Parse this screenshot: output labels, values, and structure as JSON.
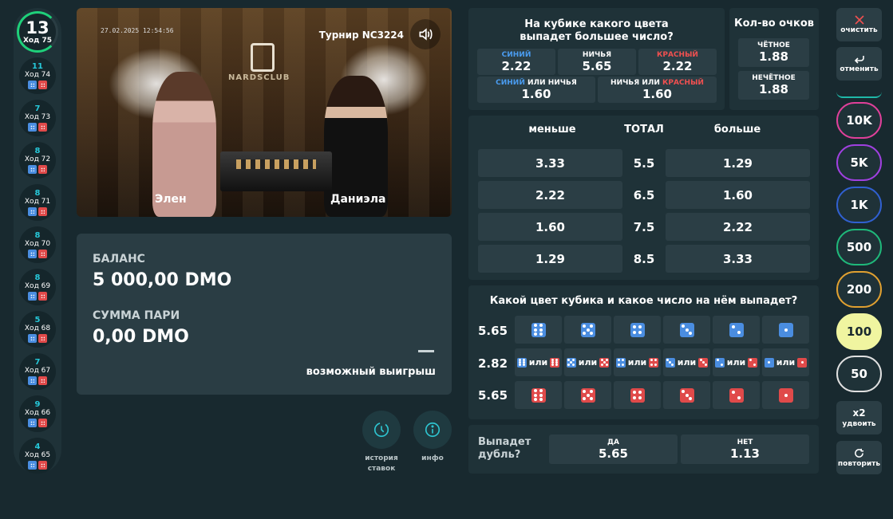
{
  "history": {
    "current": {
      "number": "13",
      "label": "Ход 75"
    },
    "items": [
      {
        "number": "11",
        "label": "Ход 74"
      },
      {
        "number": "7",
        "label": "Ход 73"
      },
      {
        "number": "8",
        "label": "Ход 72"
      },
      {
        "number": "8",
        "label": "Ход 71"
      },
      {
        "number": "8",
        "label": "Ход 70"
      },
      {
        "number": "8",
        "label": "Ход 69"
      },
      {
        "number": "5",
        "label": "Ход 68"
      },
      {
        "number": "7",
        "label": "Ход 67"
      },
      {
        "number": "9",
        "label": "Ход 66"
      },
      {
        "number": "4",
        "label": "Ход 65"
      }
    ]
  },
  "video": {
    "timestamp": "27.02.2025 12:54:56",
    "tournament": "Турнир NC3224",
    "logo": "NARDSCLUB",
    "dealer_left": "Элен",
    "dealer_right": "Даниэла"
  },
  "balance": {
    "balance_label": "БАЛАНС",
    "balance_value": "5 000,00 DMO",
    "bet_label": "СУММА ПАРИ",
    "bet_value": "0,00 DMO",
    "possible_win_label": "возможный выигрыш"
  },
  "actions": {
    "history_label_1": "история",
    "history_label_2": "ставок",
    "info_label": "инфо"
  },
  "color_bet": {
    "title_1": "На кубике какого цвета",
    "title_2": "выпадет большее число?",
    "blue": {
      "label": "СИНИЙ",
      "odds": "2.22"
    },
    "draw": {
      "label": "НИЧЬЯ",
      "odds": "5.65"
    },
    "red": {
      "label": "КРАСНЫЙ",
      "odds": "2.22"
    },
    "blue_or_draw": {
      "label_a": "СИНИЙ",
      "label_or": "ИЛИ",
      "label_b": "НИЧЬЯ",
      "odds": "1.60"
    },
    "draw_or_red": {
      "label_a": "НИЧЬЯ",
      "label_or": "ИЛИ",
      "label_b": "КРАСНЫЙ",
      "odds": "1.60"
    }
  },
  "points": {
    "title": "Кол-во очков",
    "even": {
      "label": "ЧЁТНОЕ",
      "odds": "1.88"
    },
    "odd": {
      "label": "НЕЧЁТНОЕ",
      "odds": "1.88"
    }
  },
  "total": {
    "less": "меньше",
    "title": "ТОТАЛ",
    "more": "больше",
    "rows": [
      {
        "less": "3.33",
        "total": "5.5",
        "more": "1.29"
      },
      {
        "less": "2.22",
        "total": "6.5",
        "more": "1.60"
      },
      {
        "less": "1.60",
        "total": "7.5",
        "more": "2.22"
      },
      {
        "less": "1.29",
        "total": "8.5",
        "more": "3.33"
      }
    ]
  },
  "dice_bet": {
    "title": "Какой цвет кубика и какое число на нём выпадет?",
    "row_blue": "5.65",
    "row_mixed": "2.82",
    "row_red": "5.65",
    "or_label": "или"
  },
  "double": {
    "question_1": "Выпадет",
    "question_2": "дубль?",
    "yes": {
      "label": "ДА",
      "odds": "5.65"
    },
    "no": {
      "label": "НЕТ",
      "odds": "1.13"
    }
  },
  "controls": {
    "clear": "очистить",
    "undo": "отменить",
    "double_top": "x2",
    "double": "удвоить",
    "repeat": "повторить"
  },
  "chips": {
    "c10k": "10K",
    "c5k": "5K",
    "c1k": "1K",
    "c500": "500",
    "c200": "200",
    "c100": "100",
    "c50": "50"
  },
  "colors": {
    "accent_green": "#1fd07a",
    "blue": "#4a8de0",
    "red": "#e04a4a",
    "selected_chip": "#f0f5a0"
  }
}
